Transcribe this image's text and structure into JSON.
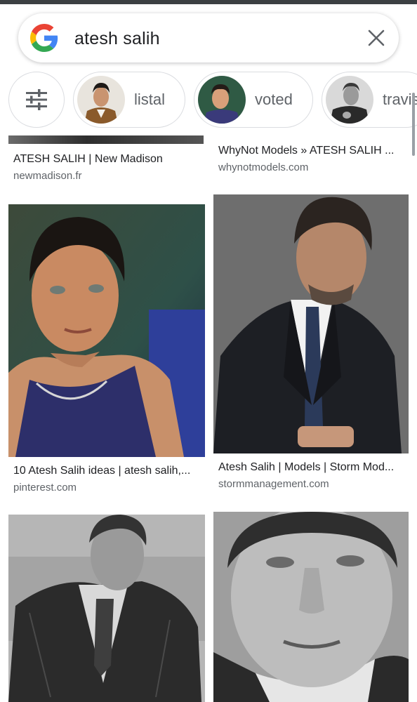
{
  "search": {
    "query": "atesh salih"
  },
  "chips": [
    {
      "label": "listal"
    },
    {
      "label": "voted"
    },
    {
      "label": "travis"
    }
  ],
  "results": [
    {
      "caption": "ATESH SALIH | New Madison",
      "source": "newmadison.fr"
    },
    {
      "caption": "WhyNot Models » ATESH SALIH ...",
      "source": "whynotmodels.com"
    },
    {
      "caption": "10 Atesh Salih ideas | atesh salih,...",
      "source": "pinterest.com"
    },
    {
      "caption": "Atesh Salih | Models | Storm Mod...",
      "source": "stormmanagement.com"
    }
  ],
  "icons": {
    "logo": "google-g-icon",
    "clear": "close-icon",
    "filter": "tune-icon"
  },
  "colors": {
    "google_blue": "#4285F4",
    "google_red": "#EA4335",
    "google_yellow": "#FBBC05",
    "google_green": "#34A853",
    "text_secondary": "#5f6368"
  }
}
